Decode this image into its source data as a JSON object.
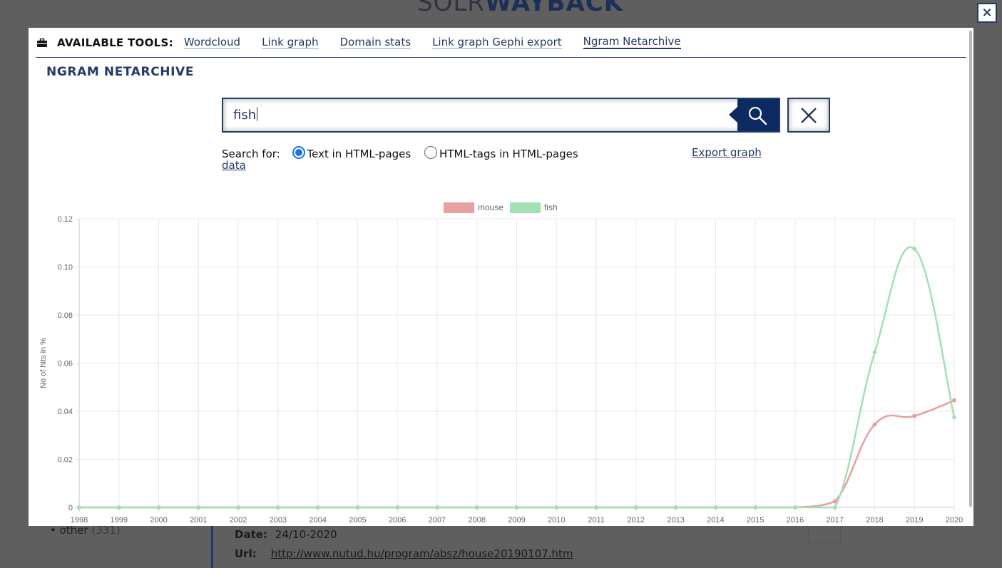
{
  "background": {
    "logo_part1": "SOLR",
    "logo_part2": "WAYBACK",
    "facet_other_label": "• other",
    "facet_other_count": "(331)",
    "date_label": "Date:",
    "date_value": "24/10-2020",
    "url_label": "Url:",
    "url_value": "http://www.nutud.hu/program/absz/house20190107.htm"
  },
  "close_label": "×",
  "toolbar": {
    "label": "AVAILABLE TOOLS:",
    "tools": [
      "Wordcloud",
      "Link graph",
      "Domain stats",
      "Link graph Gephi export",
      "Ngram Netarchive"
    ],
    "active": "Ngram Netarchive"
  },
  "section_title": "NGRAM NETARCHIVE",
  "search": {
    "value": "fish"
  },
  "search_for": {
    "label": "Search for:",
    "options": [
      "Text in HTML-pages",
      "HTML-tags in HTML-pages"
    ],
    "selected": "Text in HTML-pages"
  },
  "export_label_1": " Export graph",
  "export_label_2": "data",
  "chart_data": {
    "type": "line",
    "ylabel": "No of hits in %",
    "xlabel": "",
    "ylim": [
      0,
      0.12
    ],
    "yticks": [
      "0",
      "0.02",
      "0.04",
      "0.06",
      "0.08",
      "0.10",
      "0.12"
    ],
    "categories": [
      "1998",
      "1999",
      "2000",
      "2001",
      "2002",
      "2003",
      "2004",
      "2005",
      "2006",
      "2007",
      "2008",
      "2009",
      "2010",
      "2011",
      "2012",
      "2013",
      "2014",
      "2015",
      "2016",
      "2017",
      "2018",
      "2019",
      "2020"
    ],
    "legend_position": "top",
    "series": [
      {
        "name": "mouse",
        "color": "#e8a0a0",
        "values": [
          0,
          0,
          0,
          0,
          0,
          0,
          0,
          0,
          0,
          0,
          0,
          0,
          0,
          0,
          0,
          0,
          0,
          0,
          0,
          0.0025,
          0.0345,
          0.038,
          0.0445
        ]
      },
      {
        "name": "fish",
        "color": "#a3e0b5",
        "values": [
          0,
          0,
          0,
          0,
          0,
          0,
          0,
          0,
          0,
          0,
          0,
          0,
          0,
          0,
          0,
          0,
          0,
          0,
          0,
          0,
          0.0645,
          0.1075,
          0.0375
        ]
      }
    ]
  }
}
